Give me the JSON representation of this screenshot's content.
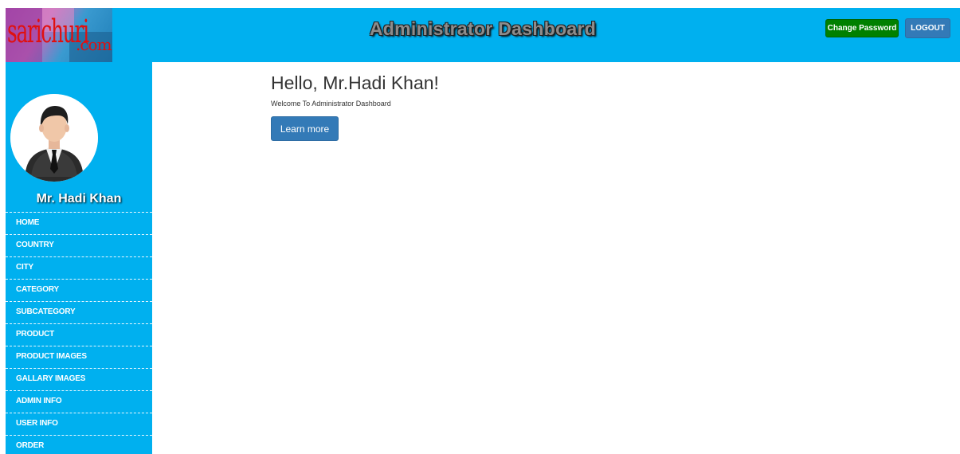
{
  "header": {
    "logo_text": "sarichuri",
    "logo_tld": ".com",
    "title": "Administrator Dashboard",
    "change_password_label": "Change Password",
    "logout_label": "LOGOUT"
  },
  "sidebar": {
    "user_name": "Mr. Hadi Khan",
    "items": [
      {
        "label": "HOME"
      },
      {
        "label": "COUNTRY"
      },
      {
        "label": "CITY"
      },
      {
        "label": "CATEGORY"
      },
      {
        "label": "SUBCATEGORY"
      },
      {
        "label": "PRODUCT"
      },
      {
        "label": "PRODUCT IMAGES"
      },
      {
        "label": "GALLARY IMAGES"
      },
      {
        "label": "ADMIN INFO"
      },
      {
        "label": "USER INFO"
      },
      {
        "label": "ORDER"
      }
    ]
  },
  "main": {
    "greeting": "Hello, Mr.Hadi Khan!",
    "welcome": "Welcome To Administrator Dashboard",
    "learn_more_label": "Learn more"
  },
  "colors": {
    "header_bg": "#00b0ef",
    "sidebar_bg": "#00b0ef",
    "change_password_bg": "#008000",
    "primary_button_bg": "#337ab7"
  },
  "icons": {
    "logo": "sarichuri-logo",
    "avatar": "businessman-avatar-icon"
  }
}
